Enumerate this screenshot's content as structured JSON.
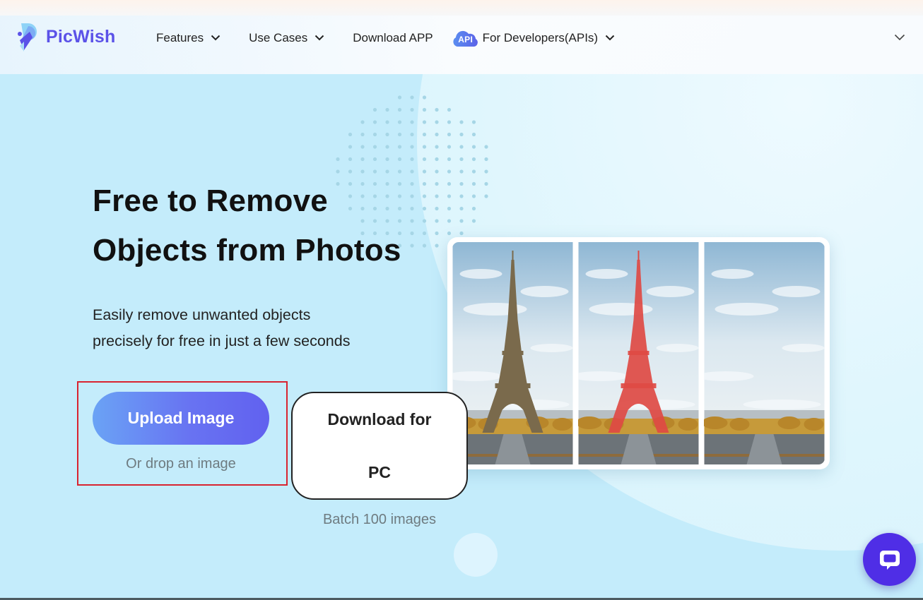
{
  "header": {
    "brand": "PicWish",
    "nav": [
      {
        "label": "Features",
        "has_dropdown": true
      },
      {
        "label": "Use Cases",
        "has_dropdown": true
      },
      {
        "label": "Download APP",
        "has_dropdown": false
      },
      {
        "label": "For Developers(APIs)",
        "has_dropdown": true,
        "badge": "API"
      }
    ],
    "right_dropdown_icon": "chevron-down-icon"
  },
  "hero": {
    "title_line1": "Free to Remove",
    "title_line2": "Objects from Photos",
    "subtitle_line1": "Easily remove unwanted objects",
    "subtitle_line2": "precisely for free in just a few seconds",
    "upload_button": "Upload Image",
    "drop_hint": "Or drop an image",
    "download_button_line1": "Download for",
    "download_button_line2": "PC",
    "batch_hint": "Batch 100 images"
  },
  "showcase": {
    "panels": [
      {
        "label": "original",
        "tower_color": "#7a6a4c"
      },
      {
        "label": "selected",
        "tower_color": "#de4a44"
      },
      {
        "label": "removed",
        "tower_color": null
      }
    ]
  },
  "colors": {
    "brand": "#5b52e8",
    "upload_gradient_start": "#6aa3f5",
    "upload_gradient_end": "#6161ef",
    "highlight_border": "#d9232f",
    "chat": "#4f2ee6",
    "page_bg": "#c4ecfb"
  },
  "chat": {
    "icon": "chat-bubble-icon"
  }
}
